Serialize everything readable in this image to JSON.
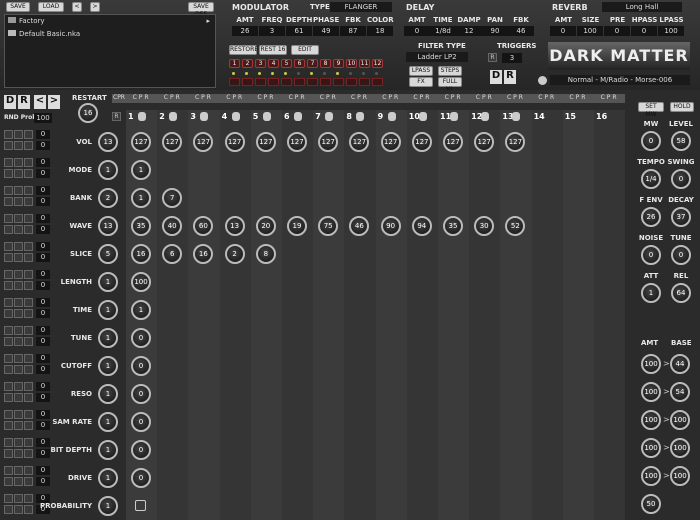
{
  "top": {
    "save": "SAVE",
    "load": "LOAD",
    "prev": "<",
    "next": ">",
    "save_def": "SAVE DEF",
    "browser": [
      {
        "name": "Factory",
        "arrow": "▸"
      },
      {
        "name": "Default Basic.nka",
        "arrow": ""
      }
    ]
  },
  "modulator": {
    "title": "MODULATOR",
    "type_label": "TYPE",
    "type_value": "FLANGER",
    "params": [
      {
        "label": "AMT",
        "value": "26"
      },
      {
        "label": "FREQ",
        "value": "3"
      },
      {
        "label": "DEPTH",
        "value": "61"
      },
      {
        "label": "PHASE",
        "value": "49"
      },
      {
        "label": "FBK",
        "value": "87"
      },
      {
        "label": "COLOR",
        "value": "18"
      }
    ]
  },
  "delay": {
    "title": "DELAY",
    "params": [
      {
        "label": "AMT",
        "value": "0"
      },
      {
        "label": "TIME",
        "value": "1/8d"
      },
      {
        "label": "DAMP",
        "value": "12"
      },
      {
        "label": "PAN",
        "value": "90"
      },
      {
        "label": "FBK",
        "value": "46"
      }
    ]
  },
  "reverb": {
    "title": "REVERB",
    "type_value": "Long Hall",
    "params": [
      {
        "label": "AMT",
        "value": "0"
      },
      {
        "label": "SIZE",
        "value": "100"
      },
      {
        "label": "PRE",
        "value": "0"
      },
      {
        "label": "HPASS",
        "value": "0"
      },
      {
        "label": "LPASS",
        "value": "100"
      }
    ]
  },
  "buttons": {
    "restore": "RESTORE",
    "rest16": "REST 16",
    "edit": "EDIT",
    "lpass": "LPASS",
    "steps": "STEPS",
    "fx": "FX",
    "full_vl": "FULL VL",
    "d": "D",
    "r": "R"
  },
  "steps_top": [
    "1",
    "2",
    "3",
    "4",
    "5",
    "6",
    "7",
    "8",
    "9",
    "10",
    "11",
    "12"
  ],
  "filter": {
    "title": "FILTER TYPE",
    "value": "Ladder LP2"
  },
  "triggers": {
    "title": "TRIGGERS",
    "value": "3",
    "r": "R"
  },
  "brand": "DARK MATTER",
  "preset": "Normal - M/Radio - Morse-006",
  "seq": {
    "d": "D",
    "r": "R",
    "prev": "<",
    "next": ">",
    "restart": "RESTART",
    "restart_val": "16",
    "rnd_label": "RND Prob",
    "rnd_val": "100",
    "c": "C",
    "p": "P",
    "r2": "R",
    "cols": [
      "1",
      "2",
      "3",
      "4",
      "5",
      "6",
      "7",
      "8",
      "9",
      "10",
      "11",
      "12",
      "13",
      "14",
      "15",
      "16"
    ],
    "rows": [
      {
        "label": "VOL",
        "knob": "13",
        "vals": [
          "127",
          "127",
          "127",
          "127",
          "127",
          "127",
          "127",
          "127",
          "127",
          "127",
          "127",
          "127",
          "127"
        ]
      },
      {
        "label": "MODE",
        "knob": "1",
        "vals": [
          "1"
        ]
      },
      {
        "label": "BANK",
        "knob": "2",
        "vals": [
          "1",
          "7"
        ]
      },
      {
        "label": "WAVE",
        "knob": "13",
        "vals": [
          "35",
          "40",
          "60",
          "13",
          "20",
          "19",
          "75",
          "46",
          "90",
          "94",
          "35",
          "30",
          "52"
        ]
      },
      {
        "label": "SLICE",
        "knob": "5",
        "vals": [
          "16",
          "6",
          "16",
          "2",
          "8"
        ]
      },
      {
        "label": "LENGTH",
        "knob": "1",
        "vals": [
          "100"
        ]
      },
      {
        "label": "TIME",
        "knob": "1",
        "vals": [
          "1"
        ]
      },
      {
        "label": "TUNE",
        "knob": "1",
        "vals": [
          "0"
        ]
      },
      {
        "label": "CUTOFF",
        "knob": "1",
        "vals": [
          "0"
        ]
      },
      {
        "label": "RESO",
        "knob": "1",
        "vals": [
          "0"
        ]
      },
      {
        "label": "SAM RATE",
        "knob": "1",
        "vals": [
          "0"
        ]
      },
      {
        "label": "BIT DEPTH",
        "knob": "1",
        "vals": [
          "0"
        ]
      },
      {
        "label": "DRIVE",
        "knob": "1",
        "vals": [
          "0"
        ]
      },
      {
        "label": "PROBABILITY",
        "knob": "1",
        "vals": [
          ""
        ]
      }
    ]
  },
  "right": {
    "set_mw": "SET MW",
    "hold": "HOLD",
    "knobs": [
      {
        "label": "MW",
        "value": "0"
      },
      {
        "label": "LEVEL",
        "value": "58"
      },
      {
        "label": "TEMPO",
        "value": "1/4"
      },
      {
        "label": "SWING",
        "value": "0"
      },
      {
        "label": "F ENV",
        "value": "26"
      },
      {
        "label": "DECAY",
        "value": "37"
      },
      {
        "label": "NOISE",
        "value": "0"
      },
      {
        "label": "TUNE",
        "value": "0"
      },
      {
        "label": "ATT",
        "value": "1"
      },
      {
        "label": "REL",
        "value": "64"
      }
    ],
    "amt": "AMT",
    "base": "BASE",
    "pairs": [
      {
        "amt": "100",
        "base": "44"
      },
      {
        "amt": "100",
        "base": "54"
      },
      {
        "amt": "100",
        "base": "100"
      },
      {
        "amt": "100",
        "base": "100"
      },
      {
        "amt": "100",
        "base": "100"
      }
    ],
    "last": "50"
  }
}
